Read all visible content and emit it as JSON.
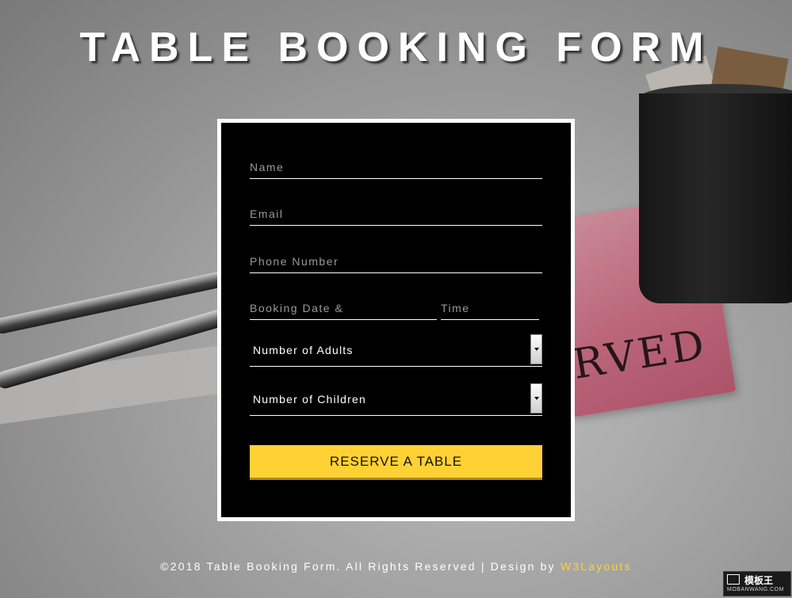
{
  "page": {
    "title": "TABLE BOOKING FORM"
  },
  "form": {
    "name_placeholder": "Name",
    "email_placeholder": "Email",
    "phone_placeholder": "Phone Number",
    "date_placeholder": "Booking Date &",
    "time_placeholder": "Time",
    "adults_label": "Number of Adults",
    "children_label": "Number of Children",
    "submit_label": "RESERVE A TABLE"
  },
  "background": {
    "sign_text": "RVED"
  },
  "footer": {
    "text": "©2018 Table Booking Form. All Rights Reserved | Design by ",
    "link_text": "W3Layouts"
  },
  "watermark": {
    "top": "模板王",
    "bottom": "MOBANWANG.COM"
  },
  "colors": {
    "accent": "#ffd135",
    "card": "#000000",
    "text": "#ffffff"
  }
}
